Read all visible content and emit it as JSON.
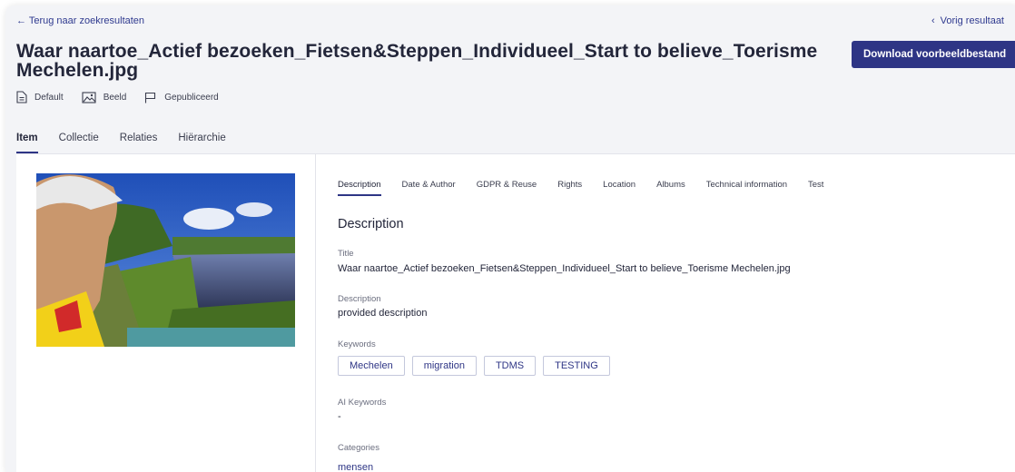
{
  "header": {
    "back_label": "← Terug naar zoekresultaten",
    "prev_label": "Vorig resultaat",
    "title": "Waar naartoe_Actief bezoeken_Fietsen&Steppen_Individueel_Start to believe_Toerisme Mechelen.jpg",
    "download_label": "Download voorbeeldbestand"
  },
  "meta": [
    {
      "label": "Default",
      "icon": "document-icon"
    },
    {
      "label": "Beeld",
      "icon": "image-icon"
    },
    {
      "label": "Gepubliceerd",
      "icon": "flag-icon"
    }
  ],
  "main_tabs": [
    {
      "label": "Item",
      "active": true
    },
    {
      "label": "Collectie",
      "active": false
    },
    {
      "label": "Relaties",
      "active": false
    },
    {
      "label": "Hiërarchie",
      "active": false
    }
  ],
  "sub_tabs": [
    {
      "label": "Description",
      "active": true
    },
    {
      "label": "Date & Author",
      "active": false
    },
    {
      "label": "GDPR & Reuse",
      "active": false
    },
    {
      "label": "Rights",
      "active": false
    },
    {
      "label": "Location",
      "active": false
    },
    {
      "label": "Albums",
      "active": false
    },
    {
      "label": "Technical information",
      "active": false
    },
    {
      "label": "Test",
      "active": false
    }
  ],
  "description": {
    "section_title": "Description",
    "title_label": "Title",
    "title_value": "Waar naartoe_Actief bezoeken_Fietsen&Steppen_Individueel_Start to believe_Toerisme Mechelen.jpg",
    "description_label": "Description",
    "description_value": "provided description",
    "keywords_label": "Keywords",
    "keywords": [
      "Mechelen",
      "migration",
      "TDMS",
      "TESTING"
    ],
    "ai_keywords_label": "AI Keywords",
    "ai_keywords_value": "-",
    "categories_label": "Categories",
    "categories_value": "mensen"
  },
  "colors": {
    "accent": "#2e3585",
    "link": "#2f3a8f",
    "page_bg": "#f3f4f7",
    "card_bg": "#ffffff"
  }
}
